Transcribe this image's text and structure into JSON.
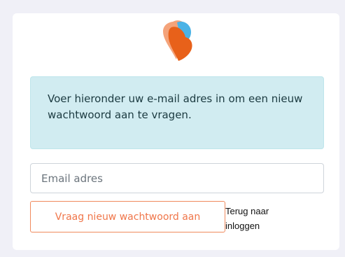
{
  "logo": {
    "icon": "heart-logo-icon",
    "colors": [
      "#e8611a",
      "#f4a37a",
      "#4bb3e6"
    ]
  },
  "alert": {
    "text": "Voer hieronder uw e-mail adres in om een nieuw wachtwoord aan te vragen."
  },
  "form": {
    "email_placeholder": "Email adres",
    "submit_label": "Vraag nieuw wachtwoord aan",
    "back_link": "Terug naar inloggen"
  },
  "colors": {
    "page_background": "#f0f0f7",
    "card_background": "#ffffff",
    "alert_background": "#d1ecf1",
    "accent": "#f0764a"
  }
}
